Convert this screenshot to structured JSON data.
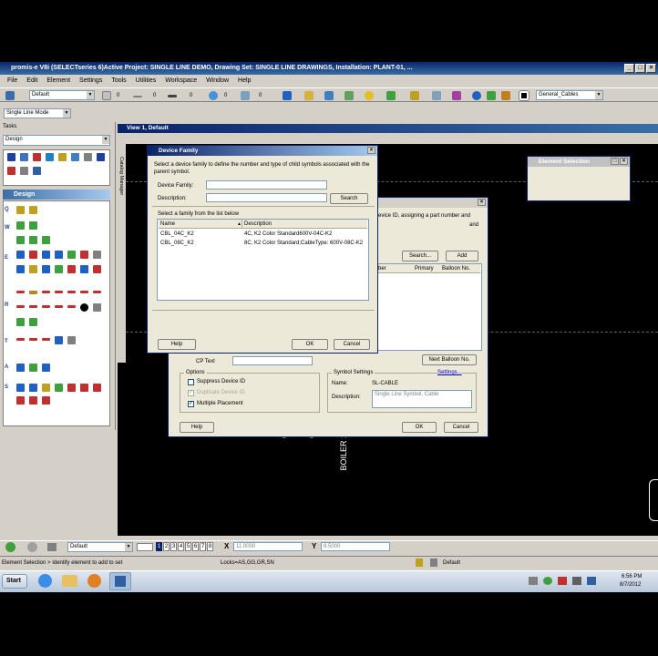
{
  "window": {
    "title": "promis-e V8i (SELECTseries 6)Active Project: SINGLE LINE DEMO, Drawing Set: SINGLE LINE DRAWINGS, Installation: PLANT-01, ..."
  },
  "menu": [
    "File",
    "Edit",
    "Element",
    "Settings",
    "Tools",
    "Utilities",
    "Workspace",
    "Window",
    "Help"
  ],
  "toolbar": {
    "level_combo": "Default",
    "num1": "0",
    "num2": "0",
    "num3": "0",
    "num4": "0",
    "num5": "0",
    "cable_combo": "General_Cables",
    "mode_combo": "Single Line Mode"
  },
  "tasks": {
    "title": "Tasks",
    "combo": "Design",
    "design_header": "Design",
    "row_letters": [
      "Q",
      "W",
      "E",
      "R",
      "T",
      "A",
      "S"
    ]
  },
  "view": {
    "title": "View 1, Default",
    "catalog_tab": "Catalog Manager",
    "boiler_text": "BOILER 2"
  },
  "element_selection": {
    "title": "Element Selection"
  },
  "device_family": {
    "title": "Device Family",
    "instructions": "Select a device family to define the number and type of child symbols associated with the parent symbol.",
    "family_label": "Device Family:",
    "description_label": "Description:",
    "search_button": "Search",
    "list_caption": "Select a family from the list below",
    "columns": [
      "Name",
      "Description"
    ],
    "rows": [
      {
        "name": "CBL_04C_K2",
        "description": "4C, K2 Color Standard600V-04C-K2"
      },
      {
        "name": "CBL_08C_K2",
        "description": "8C, K2 Color Standard;CableType: 600V-08C-K2"
      }
    ],
    "help_button": "Help",
    "ok_button": "OK",
    "cancel_button": "Cancel"
  },
  "insert_dialog": {
    "desc_tail_1": "evice ID, assigning a part number and",
    "desc_tail_2": "and",
    "search_button": "Search...",
    "add_button": "Add",
    "cols": [
      "ber",
      "Primary",
      "Balloon No."
    ],
    "next_balloon_button": "Next Balloon No.",
    "cp_text_label": "CP Text",
    "options_label": "Options",
    "suppress_label": "Suppress Device ID",
    "duplicate_label": "Duplicate Device ID",
    "multiple_label": "Multiple Placement",
    "symbol_settings_label": "Symbol Settings",
    "settings_link": "Settings...",
    "name_label": "Name:",
    "name_value": "SL-CABLE",
    "description_label": "Description:",
    "description_value": "Single Line Symbol, Cable",
    "help_button": "Help",
    "ok_button": "OK",
    "cancel_button": "Cancel"
  },
  "bottom_bar": {
    "view_combo": "Default",
    "views": [
      "1",
      "2",
      "3",
      "4",
      "5",
      "6",
      "7",
      "8"
    ],
    "x_label": "X",
    "x_value": "11.0000",
    "y_label": "Y",
    "y_value": "8.5000"
  },
  "status": {
    "prompt": "Element Selection > Identify element to add to set",
    "locks": "Locks=AS,GG,GR,SN",
    "level": "Default"
  },
  "taskbar": {
    "start": "Start",
    "time": "6:56 PM",
    "date": "8/7/2012"
  }
}
